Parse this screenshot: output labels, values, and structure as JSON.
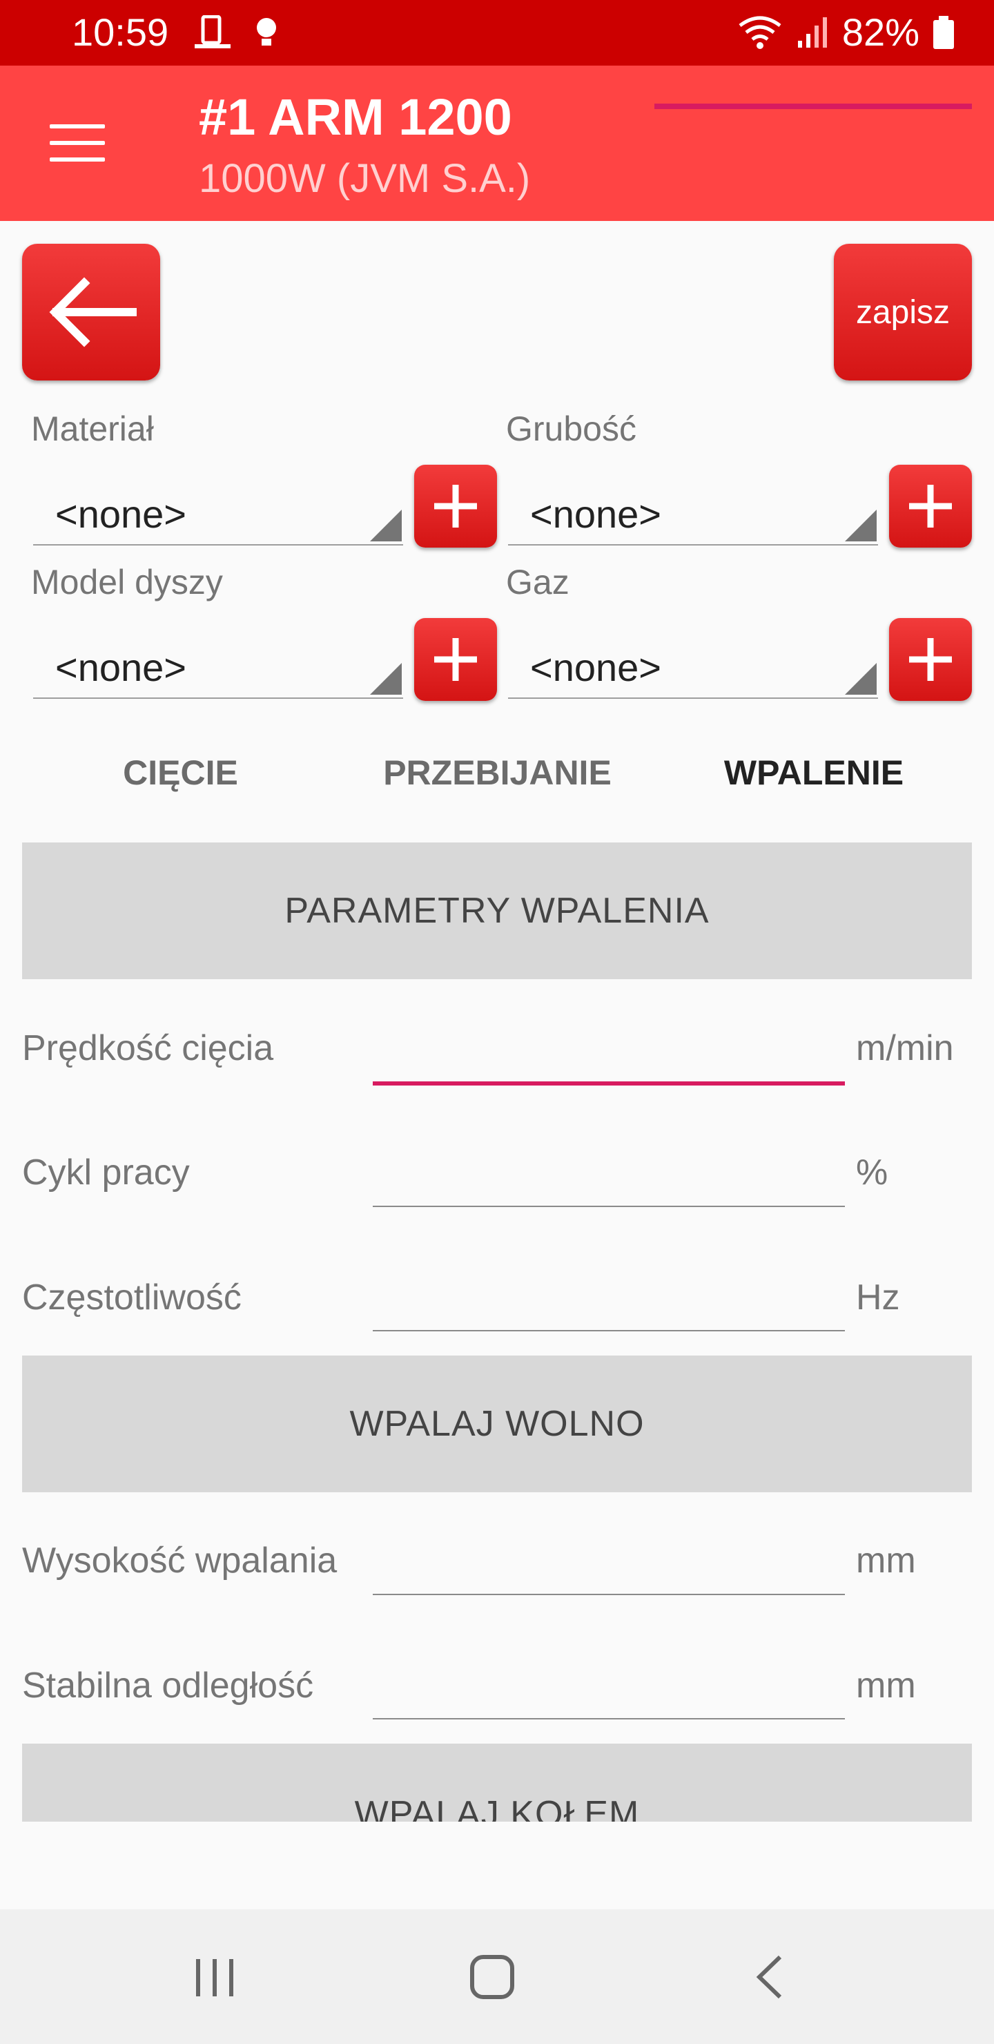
{
  "status_bar": {
    "time": "10:59",
    "battery_percent": "82%"
  },
  "app_bar": {
    "title": "#1 ARM 1200",
    "subtitle": "1000W (JVM S.A.)"
  },
  "toolbar": {
    "save_label": "zapisz"
  },
  "selectors": [
    {
      "label": "Materiał",
      "value": "<none>"
    },
    {
      "label": "Grubość",
      "value": "<none>"
    },
    {
      "label": "Model dyszy",
      "value": "<none>"
    },
    {
      "label": "Gaz",
      "value": "<none>"
    }
  ],
  "tabs": [
    {
      "label": "CIĘCIE",
      "active": false
    },
    {
      "label": "PRZEBIJANIE",
      "active": false
    },
    {
      "label": "WPALENIE",
      "active": true
    }
  ],
  "sections": {
    "wpalenie": "PARAMETRY WPALENIA",
    "wpalaj_wolno": "WPALAJ WOLNO",
    "wpalaj_kolem": "WPALAJ KOŁEM"
  },
  "params": [
    {
      "label": "Prędkość cięcia",
      "value": "",
      "unit": "m/min"
    },
    {
      "label": "Cykl pracy",
      "value": "",
      "unit": "%"
    },
    {
      "label": "Częstotliwość",
      "value": "",
      "unit": "Hz"
    },
    {
      "label": "Wysokość wpalania",
      "value": "",
      "unit": "mm"
    },
    {
      "label": "Stabilna odległość",
      "value": "",
      "unit": "mm"
    }
  ],
  "colors": {
    "status_bar": "#cc0000",
    "app_bar": "#ff4444",
    "accent": "#d81b60"
  }
}
